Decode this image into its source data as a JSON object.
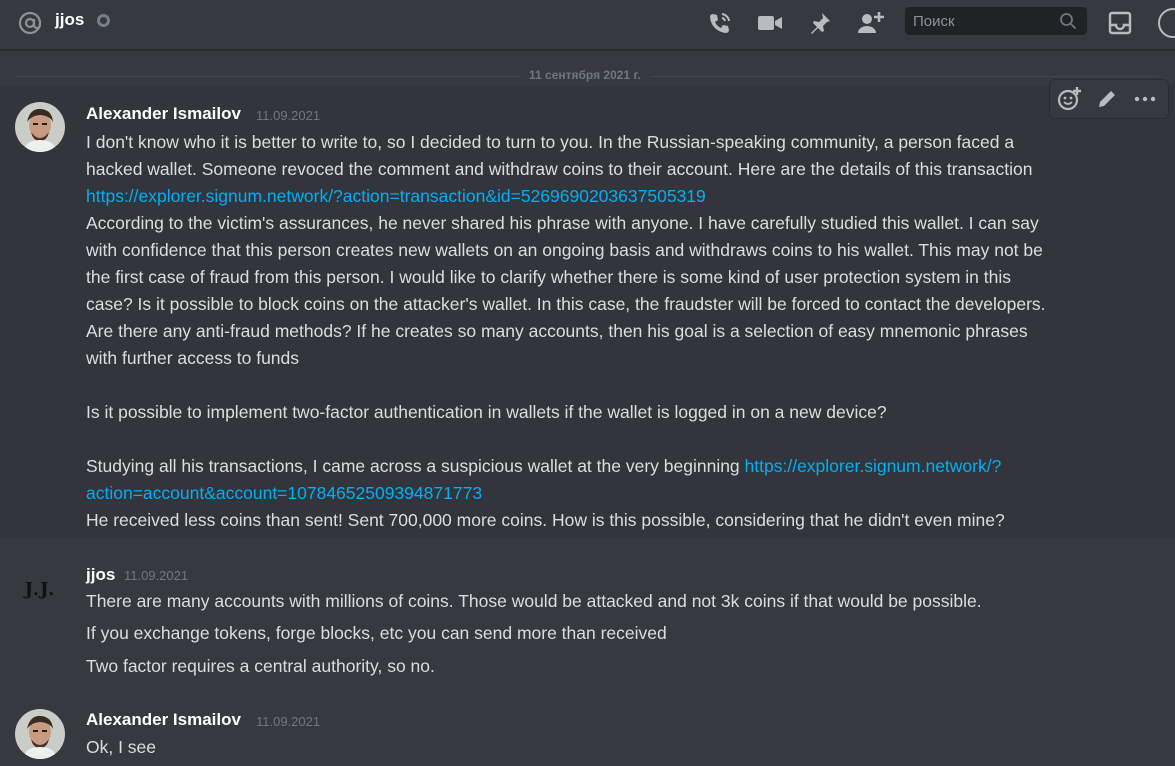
{
  "header": {
    "channel_name": "jjos",
    "search_placeholder": "Поиск",
    "icons": [
      "at-icon",
      "status-dot",
      "call-icon",
      "video-icon",
      "pin-icon",
      "add-friend-icon",
      "search-icon",
      "inbox-icon"
    ]
  },
  "divider": {
    "date": "11 сентября 2021 г."
  },
  "toolbar": {
    "icons": [
      "add-reaction-icon",
      "edit-icon",
      "more-icon"
    ]
  },
  "messages": [
    {
      "author": "Alexander Ismailov",
      "timestamp": "11.09.2021",
      "lines": {
        "l1": "I don't know who it is better to write to, so I decided to turn to you. In the Russian-speaking community, a person faced a",
        "l2": "hacked wallet. Someone revoced the comment and withdraw coins to their account. Here are the details of this transaction",
        "l3_link": "https://explorer.signum.network/?action=transaction&id=5269690203637505319",
        "l4": "According to the victim's assurances, he never shared his phrase with anyone. I have carefully studied this wallet. I can say",
        "l5": "with confidence that this person creates new wallets on an ongoing basis and withdraws coins to his wallet. This may not be",
        "l6": "the first case of fraud from this person. I would like to clarify whether there is some kind of user protection system in this",
        "l7": "case? Is it possible to block coins on the attacker's wallet. In this case, the fraudster will be forced to contact the developers.",
        "l8": "Are there any anti-fraud methods? If he creates so many accounts, then his goal is a selection of easy mnemonic phrases",
        "l9": "with further access to funds",
        "l10": "Is it possible to implement two-factor authentication in wallets if the wallet is logged in on a new device?",
        "l11_text": "Studying all his transactions, I came across a suspicious wallet at the very beginning ",
        "l11_link": "https://explorer.signum.network/?",
        "l12_link": "action=account&account=10784652509394871773",
        "l13": "He received less coins than sent! Sent 700,000 more coins. How is this possible, considering that he didn't even mine?"
      }
    },
    {
      "author": "jjos",
      "timestamp": "11.09.2021",
      "avatar_text": "J.J.",
      "lines": {
        "l1": "There are many accounts with millions of coins. Those would be attacked and not 3k coins if that would be possible.",
        "l2": "If you exchange tokens, forge blocks, etc you can send more than received",
        "l3": "Two factor requires a central authority, so no."
      }
    },
    {
      "author": "Alexander Ismailov",
      "timestamp": "11.09.2021",
      "lines": {
        "l1": "Ok, I see"
      }
    }
  ],
  "colors": {
    "background": "#36393f",
    "hover_background": "#32353b",
    "link": "#00aff4",
    "text": "#dcddde",
    "muted": "#72767d"
  }
}
